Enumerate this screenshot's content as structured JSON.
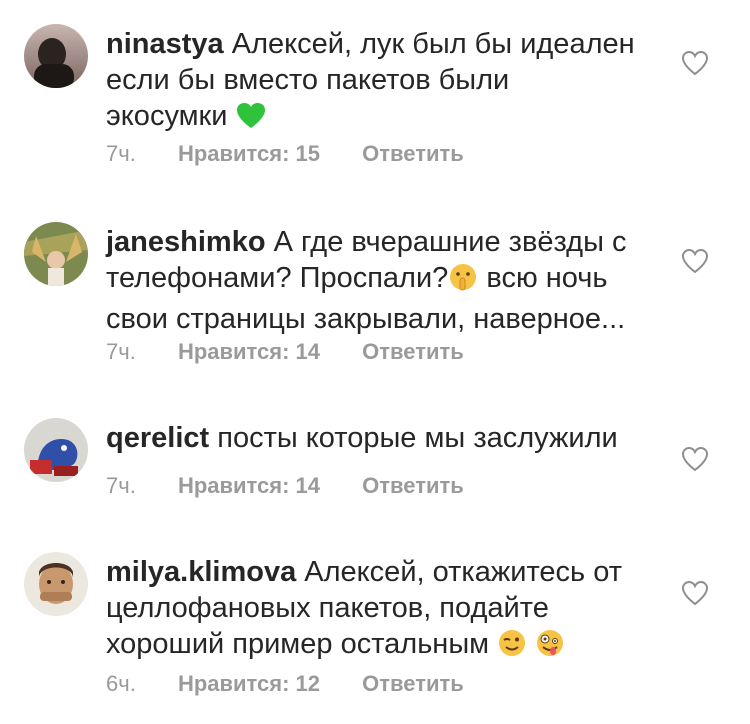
{
  "comments": [
    {
      "username": "ninastya",
      "text": "Алексей, лук был бы идеален если бы вместо пакетов были экосумки",
      "lines": [
        "Алексей, лук был бы идеален",
        "если бы вместо пакетов были",
        "экосумки"
      ],
      "emoji": [
        "green-heart-emoji"
      ],
      "time": "7ч.",
      "likes": "Нравится: 15",
      "reply": "Ответить"
    },
    {
      "username": "janeshimko",
      "text": "А где вчерашние звёзды с телефонами? Проспали? всю ночь свои страницы закрывали, наверное...",
      "lines": [
        "А где вчерашние звёзды с",
        "телефонами? Проспали?",
        "всю ночь",
        "свои страницы закрывали, наверное..."
      ],
      "emoji": [
        "shushing-face-emoji"
      ],
      "time": "7ч.",
      "likes": "Нравится: 14",
      "reply": "Ответить"
    },
    {
      "username": "qerelict",
      "text": "посты которые мы заслужили",
      "lines": [
        "посты которые мы заслужили"
      ],
      "emoji": [],
      "time": "7ч.",
      "likes": "Нравится: 14",
      "reply": "Ответить"
    },
    {
      "username": "milya.klimova",
      "text": "Алексей, откажитесь от целлофановых пакетов, подайте хороший пример остальным",
      "lines": [
        "Алексей, откажитесь от",
        "целлофановых пакетов, подайте",
        "хороший пример остальным"
      ],
      "emoji": [
        "winking-face-emoji",
        "zany-face-emoji"
      ],
      "time": "6ч.",
      "likes": "Нравится: 12",
      "reply": "Ответить"
    }
  ],
  "colors": {
    "text": "#262626",
    "meta": "#9a9a9a",
    "background": "#ffffff"
  },
  "icons": {
    "like": "heart-outline-icon"
  }
}
